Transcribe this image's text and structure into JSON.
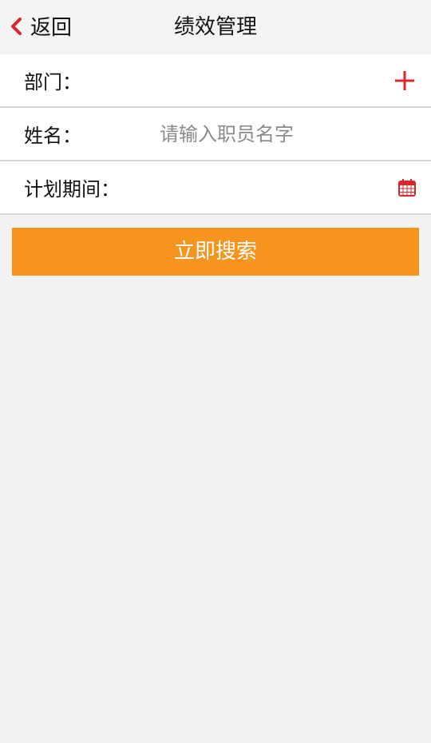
{
  "header": {
    "back_label": "返回",
    "title": "绩效管理"
  },
  "form": {
    "department_label": "部门：",
    "name_label": "姓名：",
    "name_placeholder": "请输入职员名字",
    "name_value": "",
    "period_label": "计划期间："
  },
  "actions": {
    "search_label": "立即搜索"
  },
  "icons": {
    "back": "chevron-left-icon",
    "department_add": "plus-icon",
    "period_picker": "calendar-icon"
  },
  "colors": {
    "accent_red": "#d9262c",
    "button_orange": "#f7941d",
    "background": "#f2f2f2"
  }
}
